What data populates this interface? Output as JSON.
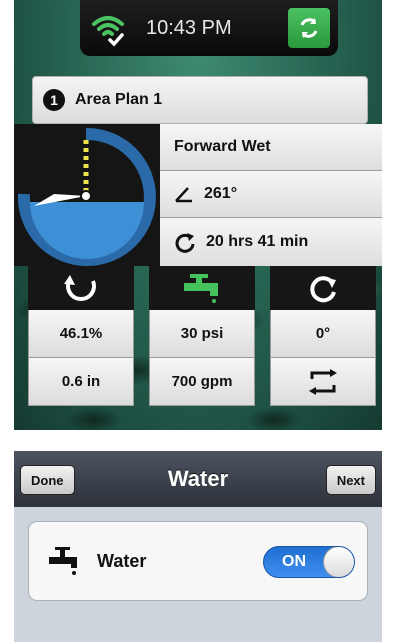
{
  "status_bar": {
    "time": "10:43 PM",
    "wifi_icon": "wifi-check-icon",
    "sync_icon": "sync-arrows-icon"
  },
  "plan": {
    "number": "1",
    "name": "Area Plan 1"
  },
  "zone": {
    "mode": "Forward Wet",
    "angle": "261°",
    "duration": "20 hrs 41 min"
  },
  "metrics": {
    "headers": [
      "return-arrow-icon",
      "faucet-icon",
      "rotate-icon"
    ],
    "rows": [
      [
        "46.1%",
        "30 psi",
        "0°"
      ],
      [
        "0.6 in",
        "700 gpm",
        "swap-icon"
      ]
    ]
  },
  "water_view": {
    "title": "Water",
    "done_label": "Done",
    "next_label": "Next",
    "row_label": "Water",
    "toggle_label": "ON",
    "toggle_on": true
  },
  "colors": {
    "accent_green": "#2a9a3c",
    "dial_blue": "#2f78bb",
    "toggle_blue": "#2f7fe0"
  }
}
